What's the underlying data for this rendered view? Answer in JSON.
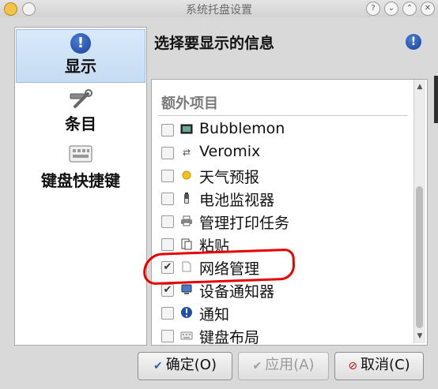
{
  "window": {
    "title": "系统托盘设置"
  },
  "titlebar_buttons": {
    "help": "?",
    "minimize": "⌄",
    "maximize": "⌃",
    "close": "✕"
  },
  "sidebar": {
    "items": [
      {
        "label": "显示",
        "icon": "info-icon",
        "selected": true
      },
      {
        "label": "条目",
        "icon": "tools-icon",
        "selected": false
      },
      {
        "label": "键盘快捷键",
        "icon": "keyboard-icon",
        "selected": false
      }
    ]
  },
  "main": {
    "title": "选择要显示的信息",
    "section_header": "额外项目",
    "items": [
      {
        "label": "Bubblemon",
        "checked": false,
        "icon": "monitor-icon"
      },
      {
        "label": "Veromix",
        "checked": false,
        "icon": "arrows-icon"
      },
      {
        "label": "天气预报",
        "checked": false,
        "icon": "weather-icon"
      },
      {
        "label": "电池监视器",
        "checked": false,
        "icon": "battery-icon"
      },
      {
        "label": "管理打印任务",
        "checked": false,
        "icon": "printer-icon"
      },
      {
        "label": "粘贴",
        "checked": false,
        "icon": "paste-icon"
      },
      {
        "label": "网络管理",
        "checked": true,
        "icon": "network-icon"
      },
      {
        "label": "设备通知器",
        "checked": true,
        "icon": "device-icon"
      },
      {
        "label": "通知",
        "checked": false,
        "icon": "notification-icon"
      },
      {
        "label": "键盘布局",
        "checked": false,
        "icon": "keyboard-layout-icon"
      }
    ]
  },
  "buttons": {
    "ok": "确定(O)",
    "apply": "应用(A)",
    "cancel": "取消(C)"
  },
  "colors": {
    "highlight": "#e60000",
    "selection": "#c6dcf3"
  }
}
